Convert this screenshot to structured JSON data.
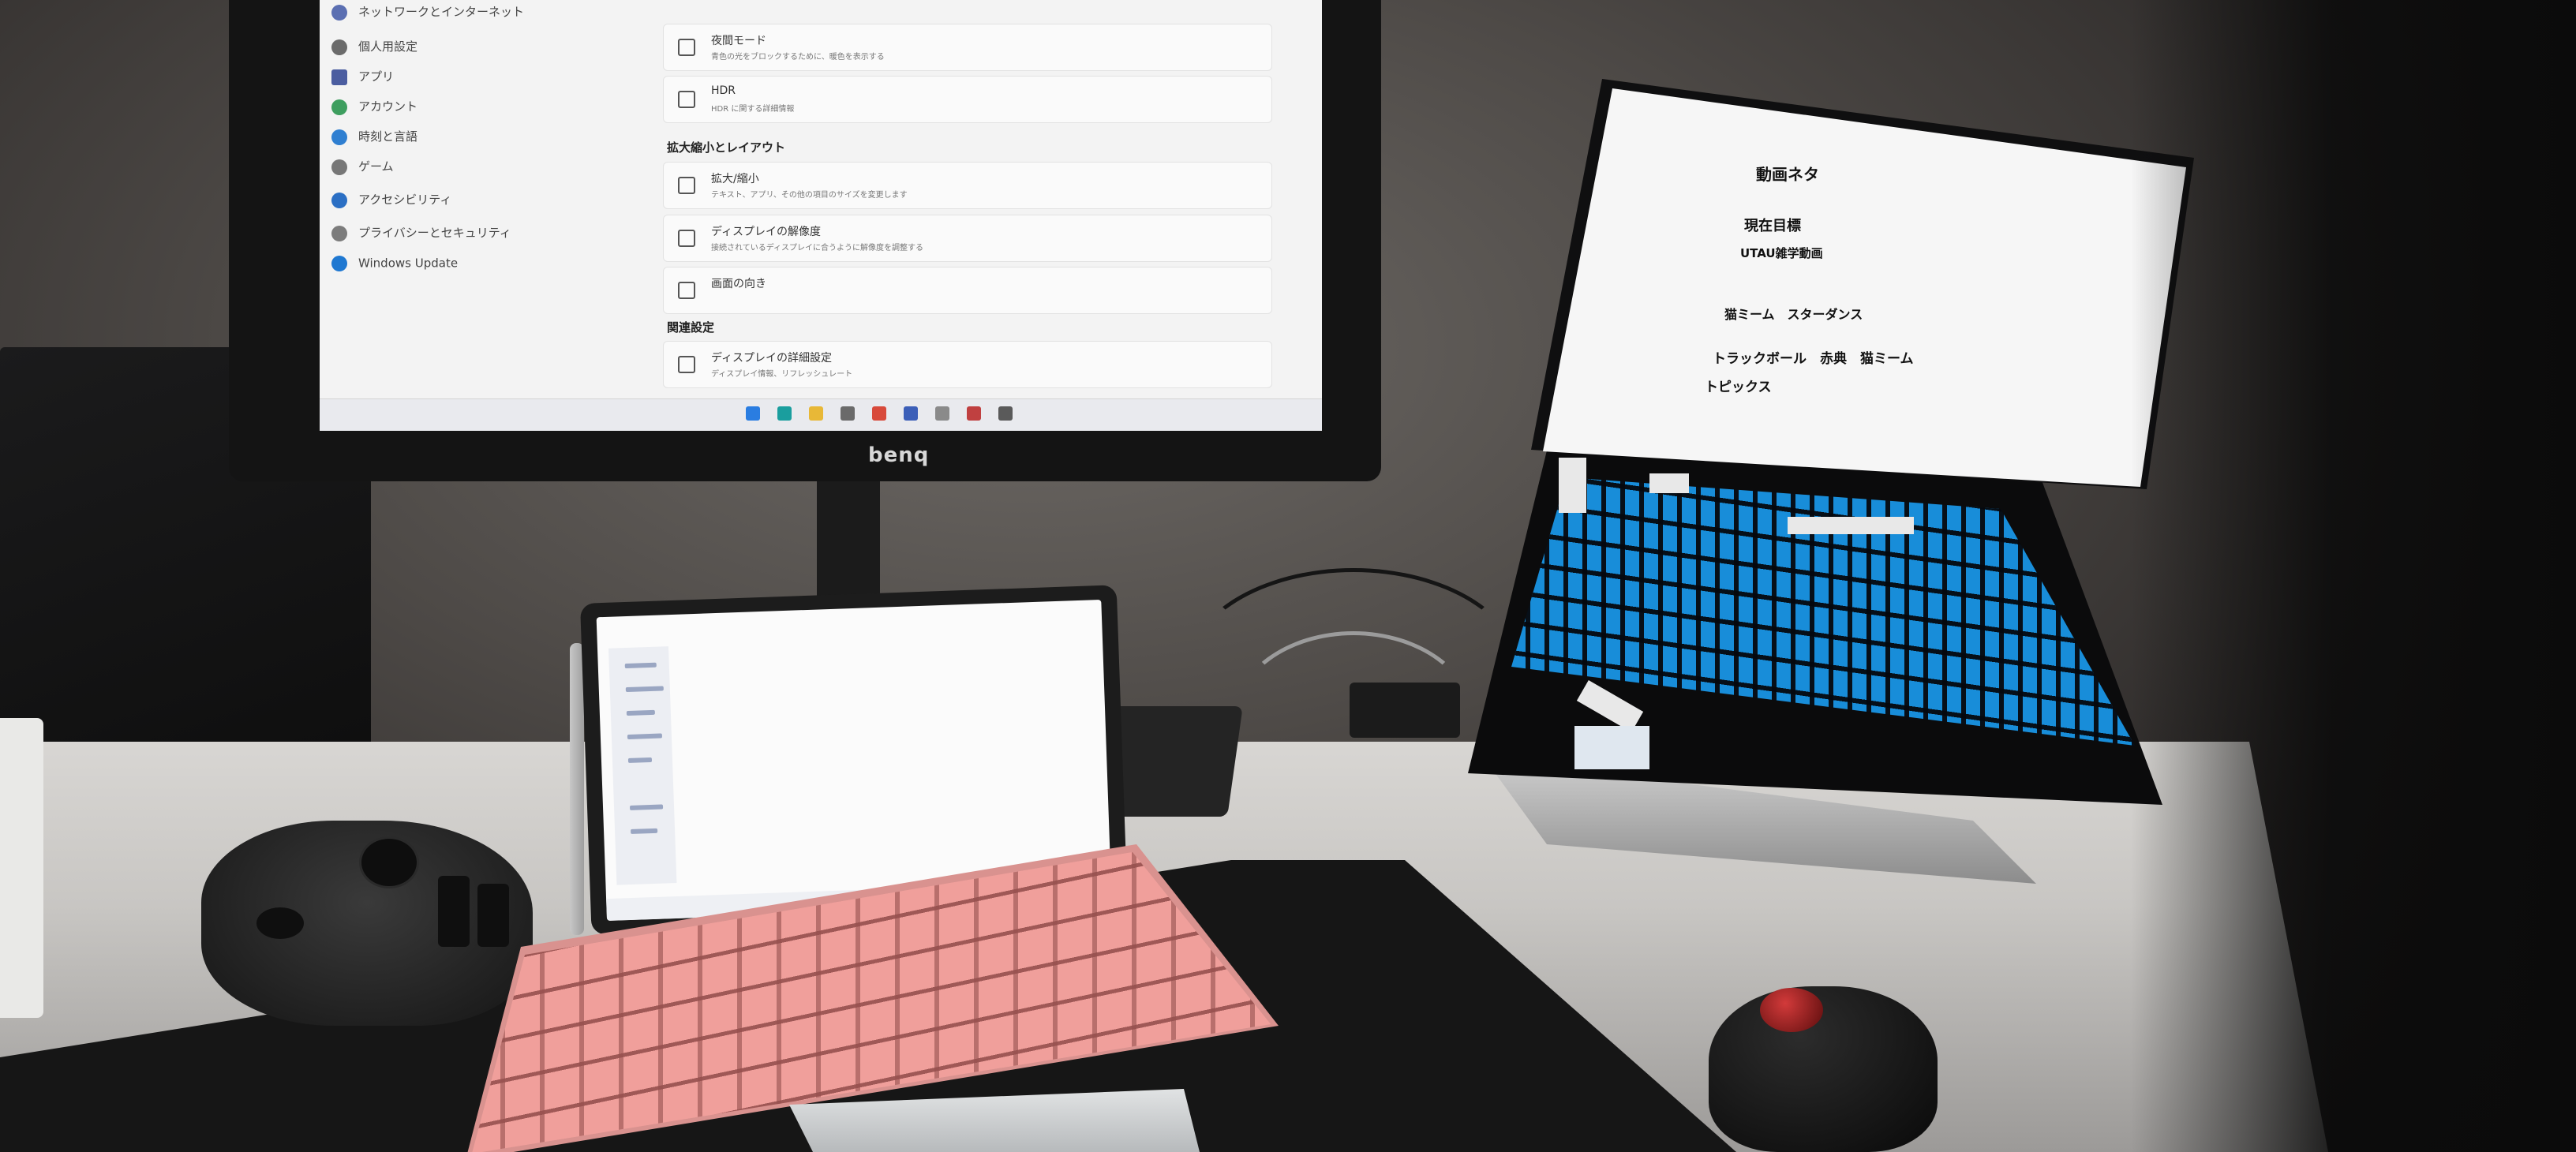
{
  "monitor": {
    "brand": "benq",
    "nav_items": [
      "ネットワークとインターネット",
      "個人用設定",
      "アプリ",
      "アカウント",
      "時刻と言語",
      "ゲーム",
      "アクセシビリティ",
      "プライバシーとセキュリティ",
      "Windows Update"
    ],
    "cards": [
      {
        "title": "夜間モード",
        "sub": "青色の光をブロックするために、暖色を表示する"
      },
      {
        "title": "HDR",
        "sub": "HDR に関する詳細情報"
      },
      {
        "title": "拡大/縮小",
        "sub": "テキスト、アプリ、その他の項目のサイズを変更します"
      },
      {
        "title": "ディスプレイの解像度",
        "sub": "接続されているディスプレイに合うように解像度を調整する"
      },
      {
        "title": "画面の向き",
        "sub": ""
      },
      {
        "title": "ディスプレイの詳細設定",
        "sub": "ディスプレイ情報、リフレッシュレート"
      }
    ],
    "section_scale": "拡大縮小とレイアウト",
    "section_related": "関連設定"
  },
  "laptop": {
    "note_title": "動画ネタ",
    "lines": [
      {
        "text": "現在目標",
        "size": 18
      },
      {
        "text": "UTAU雑学動画",
        "size": 15
      },
      {
        "text": "猫ミーム　スターダンス",
        "size": 16
      },
      {
        "text": "トラックボール　赤典　猫ミーム",
        "size": 17
      },
      {
        "text": "トピックス",
        "size": 17
      }
    ]
  }
}
